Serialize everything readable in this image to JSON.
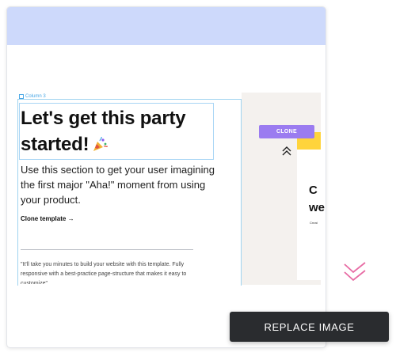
{
  "column": {
    "label": "Column 3"
  },
  "hero": {
    "headline": "Let's get this party started!",
    "lead": "Use this section to get your user imagining the first major \"Aha!\" moment from using your product.",
    "link_label": "Clone template →",
    "quote": "\"It'll take you minutes to build your website with this template. Fully responsive with a best-practice page-structure that makes it easy to customize\""
  },
  "side_preview": {
    "clone_label": "CLONE",
    "title_line1": "C",
    "title_line2": "we",
    "small_text": "Creat"
  },
  "toolbar": {
    "replace_image_label": "REPLACE IMAGE"
  },
  "icons": {
    "column": "column-icon",
    "party": "party-popper-icon",
    "collapse": "chevron-up-double-icon",
    "corner": "chevron-down-double-icon"
  },
  "colors": {
    "topbar": "#cdd9fb",
    "selection": "#a8d5f5",
    "clone_badge": "#9b7cf0",
    "accent_yellow": "#ffd43b",
    "button_dark": "#2a2c2f",
    "corner_pink": "#e76aa3"
  }
}
